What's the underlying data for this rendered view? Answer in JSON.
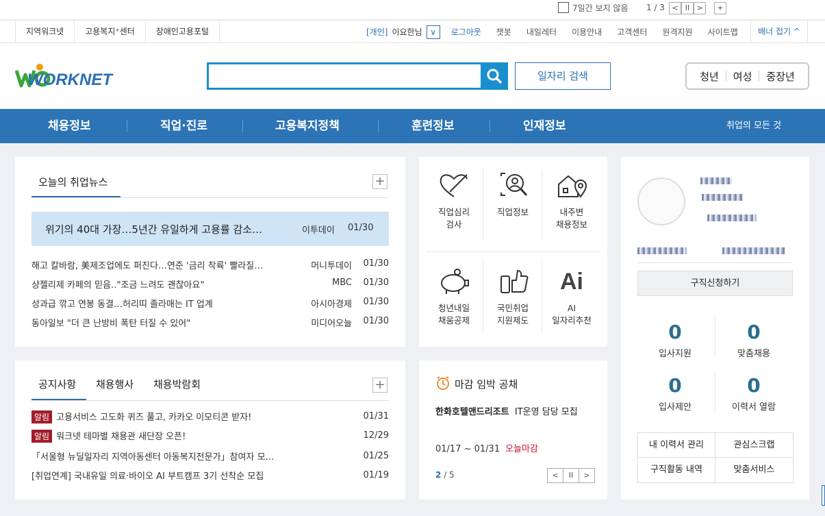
{
  "topstrip": {
    "hide_week_label": "7일간 보지 않음",
    "pager": "1 / 3",
    "prev": "<",
    "pause": "II",
    "next": ">",
    "plus": "+"
  },
  "util": {
    "left_links": [
      "지역워크넷",
      "고용복지⁺센터",
      "장애인고용포털"
    ],
    "member_tag": "[개인]",
    "member_name": "이요한님",
    "dropdown": "∨",
    "logout": "로그아웃",
    "links": [
      "챗봇",
      "내일레터",
      "이용안내",
      "고객센터",
      "원격지원",
      "사이트맵"
    ],
    "banner_toggle": "배너 접기 ^"
  },
  "header": {
    "logo_text": "WORKNET",
    "search_placeholder": "",
    "job_search_label": "일자리 검색",
    "segments": [
      "청년",
      "여성",
      "중장년"
    ]
  },
  "gnb": {
    "items": [
      "채용정보",
      "직업·진로",
      "고용복지정책",
      "훈련정보",
      "인재정보"
    ],
    "all_label": "취업의 모든 것"
  },
  "news": {
    "tab": "오늘의 취업뉴스",
    "plus": "+",
    "headline": {
      "title": "위기의 40대 가장…5년간 유일하게 고용률 감소…",
      "source": "이투데이",
      "date": "01/30"
    },
    "rows": [
      {
        "title": "해고 칼바람, 美제조업에도 퍼진다…연준 '금리 착륙' 빨라질…",
        "source": "머니투데이",
        "date": "01/30"
      },
      {
        "title": "샹젤리제 카페의 믿음‥\"조금 느려도 괜찮아요\"",
        "source": "MBC",
        "date": "01/30"
      },
      {
        "title": "성과급 깎고 연봉 동결…허리띠 졸라매는 IT 업계",
        "source": "아시아경제",
        "date": "01/30"
      },
      {
        "title": "동아일보 \"더 큰 난방비 폭탄 터질 수 있어\"",
        "source": "미디어오늘",
        "date": "01/30"
      }
    ]
  },
  "quick": {
    "items": [
      {
        "label": "직업심리\n검사",
        "icon": "heart-pencil-icon"
      },
      {
        "label": "직업정보",
        "icon": "magnifier-person-icon"
      },
      {
        "label": "내주변\n채용정보",
        "icon": "house-pin-icon"
      },
      {
        "label": "청년내일\n채움공제",
        "icon": "piggy-bank-icon"
      },
      {
        "label": "국민취업\n지원제도",
        "icon": "thumbs-up-phone-icon"
      },
      {
        "label": "AI\n일자리추천",
        "icon": "ai-text-icon"
      }
    ],
    "ai_glyph": "Ai"
  },
  "notice": {
    "tabs": [
      "공지사항",
      "채용행사",
      "채용박람회"
    ],
    "plus": "+",
    "badge": "알림",
    "rows": [
      {
        "badge": true,
        "title": "고용서비스 고도화 퀴즈 풀고, 카카오 이모티콘 받자!",
        "date": "01/31"
      },
      {
        "badge": true,
        "title": "워크넷 테마별 채용관 새단장 오픈!",
        "date": "12/29"
      },
      {
        "badge": false,
        "title": "「서울형 뉴딜일자리 지역아동센터 아동복지전문가」참여자 모…",
        "date": "01/25"
      },
      {
        "badge": false,
        "title": "[취업연계] 국내유일 의료·바이오 AI 부트캠프 3기 선착순 모집",
        "date": "01/19"
      }
    ]
  },
  "deadline": {
    "title": "마감 임박 공채",
    "company": "한화호텔앤드리조트",
    "job": "IT운영 담당 모집",
    "period": "01/17 ~ 01/31",
    "status": "오늘마감",
    "page_current": "2",
    "page_total": "/ 5",
    "prev": "<",
    "pause": "II",
    "next": ">"
  },
  "profile": {
    "apply_label": "구직신청하기",
    "stats": [
      {
        "value": "0",
        "label": "입사지원"
      },
      {
        "value": "0",
        "label": "맞춤채용"
      },
      {
        "value": "0",
        "label": "입사제안"
      },
      {
        "value": "0",
        "label": "이력서 열람"
      }
    ],
    "grid": [
      "내 이력서 관리",
      "관심스크랩",
      "구직활동 내역",
      "맞춤서비스"
    ]
  },
  "colors": {
    "brand": "#2c74b5",
    "search": "#1a8fcd",
    "badge": "#a11d2b",
    "headline_bg": "#cfe4f5",
    "deadline_red": "#c8102e"
  }
}
